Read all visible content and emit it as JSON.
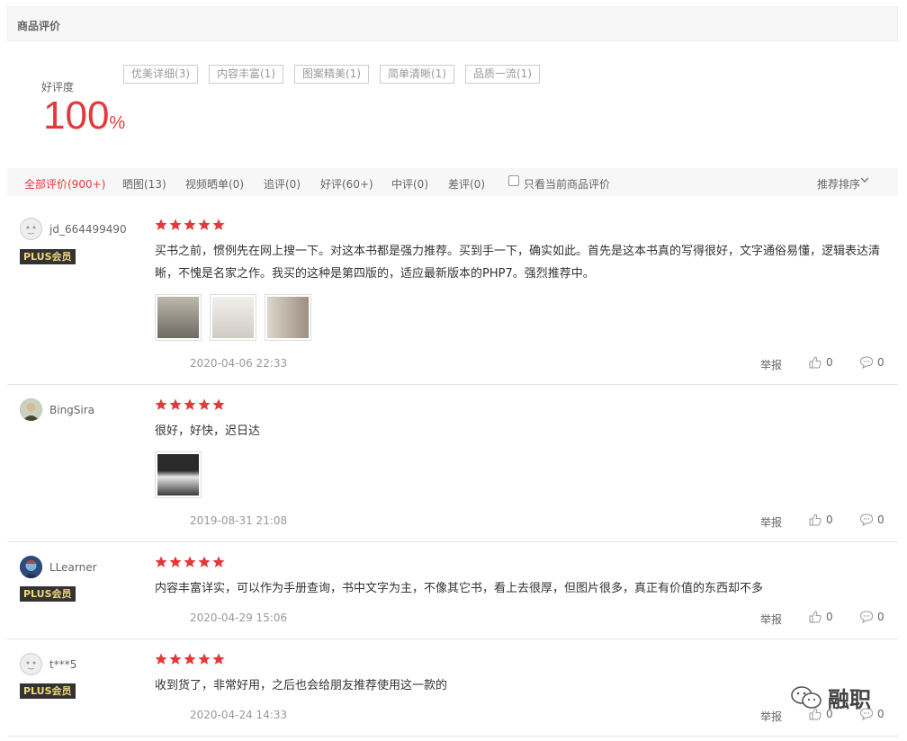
{
  "header": {
    "title": "商品评价"
  },
  "rating": {
    "label": "好评度",
    "value": "100",
    "unit": "%"
  },
  "tags": [
    "优美详细(3)",
    "内容丰富(1)",
    "图案精美(1)",
    "简单清晰(1)",
    "品质一流(1)"
  ],
  "filters": {
    "all": "全部评价(900+)",
    "pics": "晒图(13)",
    "video": "视频晒单(0)",
    "followup": "追评(0)",
    "good": "好评(60+)",
    "medium": "中评(0)",
    "bad": "差评(0)",
    "current_only": "只看当前商品评价",
    "sort": "推荐排序"
  },
  "colors": {
    "accent": "#e4393c",
    "plus_bg": "#333333",
    "plus_text": "#f0d77a"
  },
  "reviews": [
    {
      "user": "jd_664499490",
      "badge": "PLUS会员",
      "stars": 5,
      "text": "买书之前，惯例先在网上搜一下。对这本书都是强力推荐。买到手一下，确实如此。首先是这本书真的写得很好，文字通俗易懂，逻辑表达清晰，不愧是名家之作。我买的这种是第四版的，适应最新版本的PHP7。强烈推荐中。",
      "date": "2020-04-06 22:33",
      "report": "举报",
      "likes": "0",
      "comments": "0"
    },
    {
      "user": "BingSira",
      "badge": "",
      "stars": 5,
      "text": "很好，好快，迟日达",
      "date": "2019-08-31 21:08",
      "report": "举报",
      "likes": "0",
      "comments": "0"
    },
    {
      "user": "LLearner",
      "badge": "PLUS会员",
      "stars": 5,
      "text": "内容丰富详实，可以作为手册查询，书中文字为主，不像其它书，看上去很厚，但图片很多，真正有价值的东西却不多",
      "date": "2020-04-29 15:06",
      "report": "举报",
      "likes": "0",
      "comments": "0"
    },
    {
      "user": "t***5",
      "badge": "PLUS会员",
      "stars": 5,
      "text": "收到货了，非常好用，之后也会给朋友推荐使用这一款的",
      "date": "2020-04-24 14:33",
      "report": "举报",
      "likes": "0",
      "comments": "0"
    }
  ],
  "watermark": {
    "text": "融职",
    "icon": "wechat-icon"
  }
}
